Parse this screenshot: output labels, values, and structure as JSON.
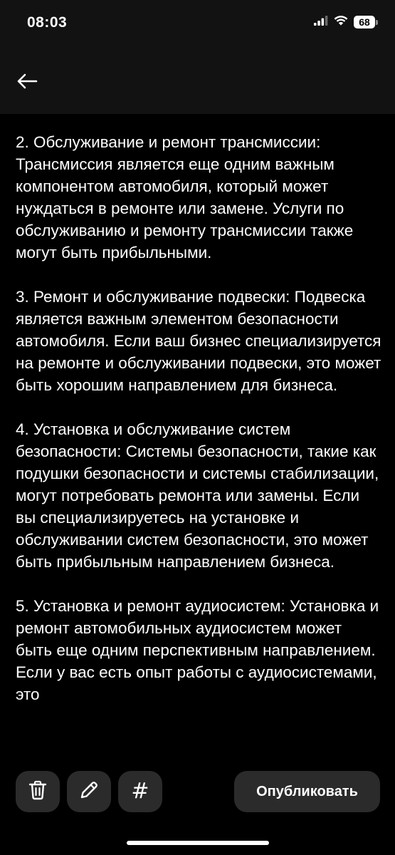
{
  "status_bar": {
    "time": "08:03",
    "battery": "68"
  },
  "article": {
    "paragraphs": [
      "2. Обслуживание и ремонт трансмиссии: Трансмиссия является еще одним важным компонентом автомобиля, который может нуждаться в ремонте или замене. Услуги по обслуживанию и ремонту трансмиссии также могут быть прибыльными.",
      "3. Ремонт и обслуживание подвески: Подвеска является важным элементом безопасности автомобиля. Если ваш бизнес специализируется на ремонте и обслуживании подвески, это может быть хорошим направлением для бизнеса.",
      "4. Установка и обслуживание систем безопасности: Системы безопасности, такие как подушки безопасности и системы стабилизации, могут потребовать ремонта или замены. Если вы специализируетесь на установке и обслуживании систем безопасности, это может быть прибыльным направлением бизнеса.",
      "5. Установка и ремонт аудиосистем: Установка и ремонт автомобильных аудиосистем может быть еще одним перспективным направлением. Если у вас есть опыт работы с аудиосистемами, это"
    ]
  },
  "toolbar": {
    "hash_label": "#",
    "publish_label": "Опубликовать"
  },
  "icons": {
    "back": "arrow-left-icon",
    "trash": "trash-icon",
    "pencil": "pencil-icon",
    "signal": "cellular-signal-icon",
    "wifi": "wifi-icon",
    "battery": "battery-icon"
  },
  "colors": {
    "background": "#000000",
    "header_background": "#121212",
    "button_background": "#2b2b2b",
    "text": "#ffffff"
  }
}
